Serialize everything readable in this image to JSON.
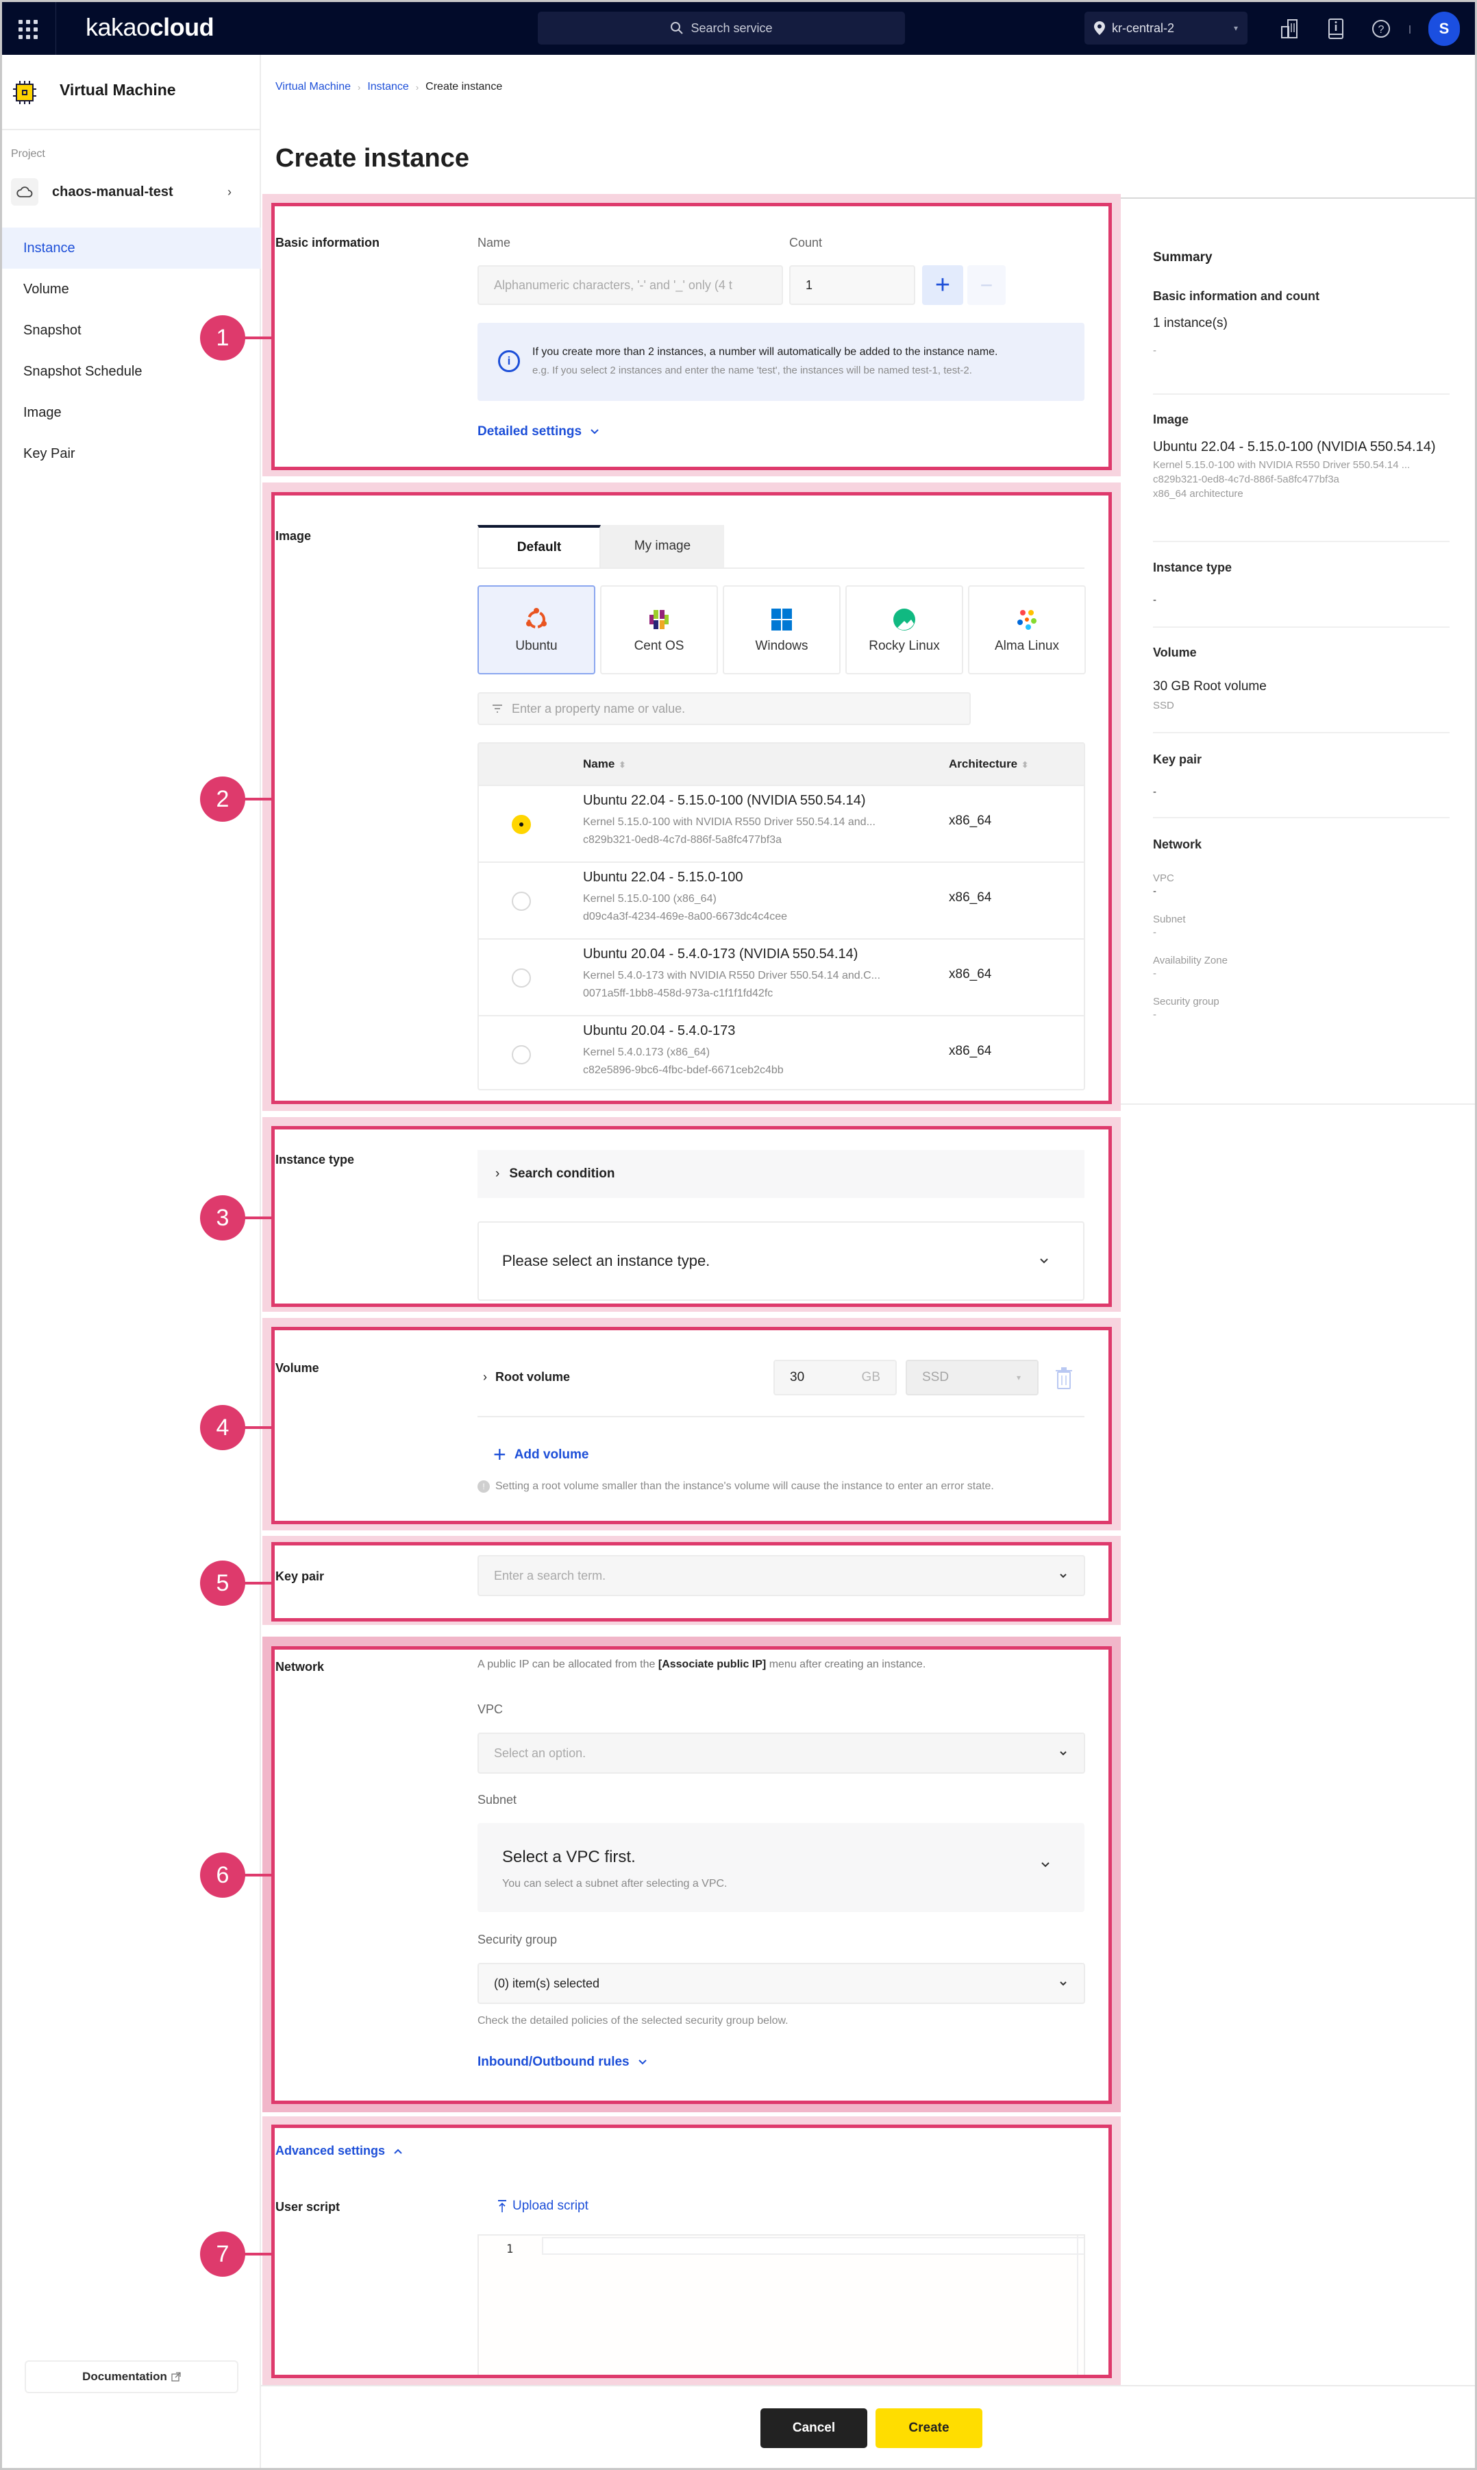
{
  "topbar": {
    "brand_light": "kakao",
    "brand_bold": "cloud",
    "search_placeholder": "Search service",
    "region": "kr-central-2",
    "avatar_initial": "S"
  },
  "sidebar": {
    "service_title": "Virtual Machine",
    "project_label": "Project",
    "project_name": "chaos-manual-test",
    "items": [
      {
        "label": "Instance",
        "active": true
      },
      {
        "label": "Volume",
        "active": false
      },
      {
        "label": "Snapshot",
        "active": false
      },
      {
        "label": "Snapshot Schedule",
        "active": false
      },
      {
        "label": "Image",
        "active": false
      },
      {
        "label": "Key Pair",
        "active": false
      }
    ],
    "documentation_label": "Documentation"
  },
  "breadcrumb": [
    "Virtual Machine",
    "Instance",
    "Create instance"
  ],
  "page_title": "Create instance",
  "markers": [
    "1",
    "2",
    "3",
    "4",
    "5",
    "6",
    "7"
  ],
  "basic_info": {
    "label": "Basic information",
    "name_label": "Name",
    "name_placeholder": "Alphanumeric characters, '-' and '_' only (4 t",
    "count_label": "Count",
    "count_value": "1",
    "plus": "+",
    "minus": "−",
    "info_line1": "If you create more than 2 instances, a number will automatically be added to the instance name.",
    "info_line2": "e.g. If you select 2 instances and enter the name 'test', the instances will be named test-1, test-2.",
    "detailed_settings": "Detailed settings"
  },
  "image": {
    "label": "Image",
    "tabs": [
      {
        "label": "Default",
        "active": true
      },
      {
        "label": "My image",
        "active": false
      }
    ],
    "os_options": [
      {
        "label": "Ubuntu",
        "selected": true
      },
      {
        "label": "Cent OS",
        "selected": false
      },
      {
        "label": "Windows",
        "selected": false
      },
      {
        "label": "Rocky Linux",
        "selected": false
      },
      {
        "label": "Alma Linux",
        "selected": false
      }
    ],
    "filter_placeholder": "Enter a property name or value.",
    "columns": [
      "Name",
      "Architecture"
    ],
    "rows": [
      {
        "name": "Ubuntu 22.04 - 5.15.0-100 (NVIDIA 550.54.14)",
        "desc": "Kernel 5.15.0-100 with NVIDIA R550 Driver 550.54.14 and...",
        "id": "c829b321-0ed8-4c7d-886f-5a8fc477bf3a",
        "arch": "x86_64",
        "selected": true
      },
      {
        "name": "Ubuntu 22.04 - 5.15.0-100",
        "desc": "Kernel 5.15.0-100 (x86_64)",
        "id": "d09c4a3f-4234-469e-8a00-6673dc4c4cee",
        "arch": "x86_64",
        "selected": false
      },
      {
        "name": "Ubuntu 20.04 - 5.4.0-173 (NVIDIA 550.54.14)",
        "desc": "Kernel 5.4.0-173 with NVIDIA R550 Driver 550.54.14 and.C...",
        "id": "0071a5ff-1bb8-458d-973a-c1f1f1fd42fc",
        "arch": "x86_64",
        "selected": false
      },
      {
        "name": "Ubuntu 20.04 - 5.4.0-173",
        "desc": "Kernel 5.4.0.173 (x86_64)",
        "id": "c82e5896-9bc6-4fbc-bdef-6671ceb2c4bb",
        "arch": "x86_64",
        "selected": false
      }
    ]
  },
  "instance_type": {
    "label": "Instance type",
    "search_condition": "Search condition",
    "select_placeholder": "Please select an instance type."
  },
  "volume": {
    "label": "Volume",
    "root_volume_label": "Root volume",
    "size_value": "30",
    "size_unit": "GB",
    "type_value": "SSD",
    "add_volume": "Add volume",
    "note": "Setting a root volume smaller than the instance's volume will cause the instance to enter an error state."
  },
  "key_pair": {
    "label": "Key pair",
    "placeholder": "Enter a search term."
  },
  "network": {
    "label": "Network",
    "note_prefix": "A public IP can be allocated from the ",
    "note_bold": "[Associate public IP]",
    "note_suffix": " menu after creating an instance.",
    "vpc_label": "VPC",
    "vpc_placeholder": "Select an option.",
    "subnet_label": "Subnet",
    "subnet_title": "Select a VPC first.",
    "subnet_sub": "You can select a subnet after selecting a VPC.",
    "sg_label": "Security group",
    "sg_value": "(0) item(s) selected",
    "sg_help": "Check the detailed policies of the selected security group below.",
    "rules_link": "Inbound/Outbound rules"
  },
  "advanced": {
    "toggle_label": "Advanced settings",
    "user_script_label": "User script",
    "upload_script": "Upload script",
    "editor_line_number": "1"
  },
  "footer": {
    "cancel": "Cancel",
    "create": "Create"
  },
  "summary": {
    "title": "Summary",
    "basic": {
      "title": "Basic information and count",
      "value": "1 instance(s)",
      "detail": "-"
    },
    "image": {
      "title": "Image",
      "value": "Ubuntu 22.04 - 5.15.0-100 (NVIDIA 550.54.14)",
      "lines": [
        "Kernel 5.15.0-100 with NVIDIA R550 Driver 550.54.14 ...",
        "c829b321-0ed8-4c7d-886f-5a8fc477bf3a",
        "x86_64 architecture"
      ]
    },
    "instance_type": {
      "title": "Instance type",
      "value": "-"
    },
    "volume": {
      "title": "Volume",
      "value": "30 GB Root volume",
      "detail": "SSD"
    },
    "key_pair": {
      "title": "Key pair",
      "value": "-"
    },
    "network": {
      "title": "Network",
      "fields": [
        {
          "label": "VPC",
          "value": "-"
        },
        {
          "label": "Subnet",
          "value": "-"
        },
        {
          "label": "Availability Zone",
          "value": "-"
        },
        {
          "label": "Security group",
          "value": "-"
        }
      ]
    }
  },
  "colors": {
    "brand_blue": "#1d4fd8",
    "highlight": "#de3a6c",
    "create_yellow": "#ffdd00",
    "topbar_navy": "#020b2a"
  }
}
